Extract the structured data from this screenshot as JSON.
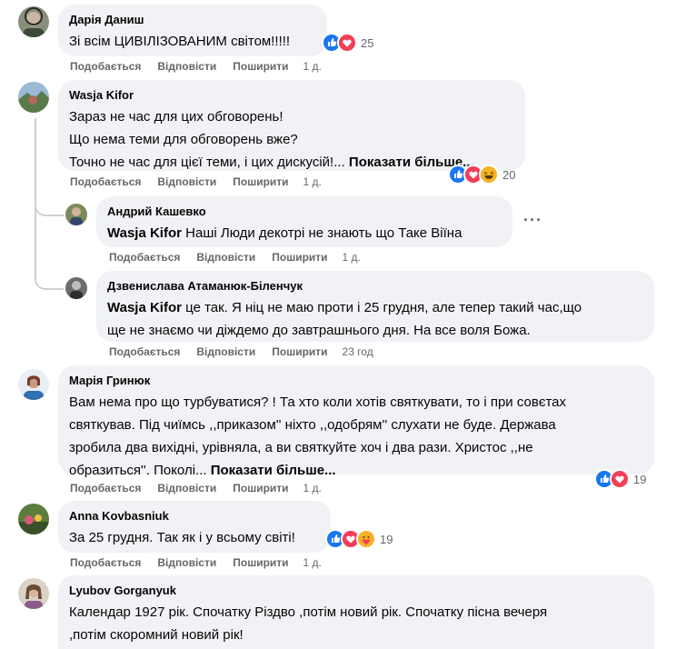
{
  "actions": {
    "like": "Подобається",
    "reply": "Відповісти",
    "share": "Поширити"
  },
  "comments": [
    {
      "author": "Дарія Даниш",
      "lines": [
        "Зі всім ЦИВІЛІЗОВАНИМ світом!!!!!"
      ],
      "reactions": {
        "count": "25",
        "icons": [
          "like-icon",
          "love-icon"
        ]
      },
      "time": "1 д."
    },
    {
      "author": "Wasja Kifor",
      "lines": [
        "Зараз не час для цих обговорень!",
        "Що нема теми для обговорень вже?",
        "Точно не час для цієї теми, і цих дискусій!..."
      ],
      "more": "Показати більше...",
      "reactions": {
        "count": "20",
        "icons": [
          "like-icon",
          "love-icon",
          "haha-icon"
        ]
      },
      "time": "1 д."
    },
    {
      "author": "Андрий Кашевко",
      "mention": "Wasja Kifor",
      "lines": [
        "Наші Люди декотрі не знають що Таке Віїна"
      ],
      "time": "1 д.",
      "menu": "···"
    },
    {
      "author": "Дзвенислава Атаманюк-Біленчук",
      "mention": "Wasja Kifor",
      "lines": [
        "це так. Я ніц не маю проти і 25 грудня, але тепер такий час,що",
        "ще не знаємо чи діждемо до завтрашнього дня. На все воля Божа."
      ],
      "time": "23 год"
    },
    {
      "author": "Марія Гринюк",
      "lines": [
        "Вам нема про що турбуватися? ! Та хто коли хотів святкувати, то і при совєтах",
        "святкував. Під чиїмсь ,,приказом'' ніхто ,,одобрям'' слухати не буде. Держава",
        "зробила два вихідні, урівняла, а ви святкуйте хоч і два рази. Христос ,,не",
        "образиться''. Поколі..."
      ],
      "more": "Показати більше...",
      "reactions": {
        "count": "19",
        "icons": [
          "like-icon",
          "love-icon"
        ]
      },
      "time": "1 д."
    },
    {
      "author": "Anna Kovbasniuk",
      "lines": [
        "За 25 грудня. Так як і у всьому світі!"
      ],
      "reactions": {
        "count": "19",
        "icons": [
          "like-icon",
          "love-icon",
          "care-icon"
        ]
      },
      "time": "1 д."
    },
    {
      "author": "Lyubov Gorganyuk",
      "lines": [
        "Календар 1927 рік. Спочатку Різдво ,потім новий рік. Спочатку пісна вечеря",
        ",потім скоромний новий рік!"
      ]
    }
  ],
  "colors": {
    "bubble": "#f0f2f5",
    "meta": "#65676b",
    "like": "#1877f2",
    "love": "#f33e58",
    "haha": "#f7b125"
  }
}
